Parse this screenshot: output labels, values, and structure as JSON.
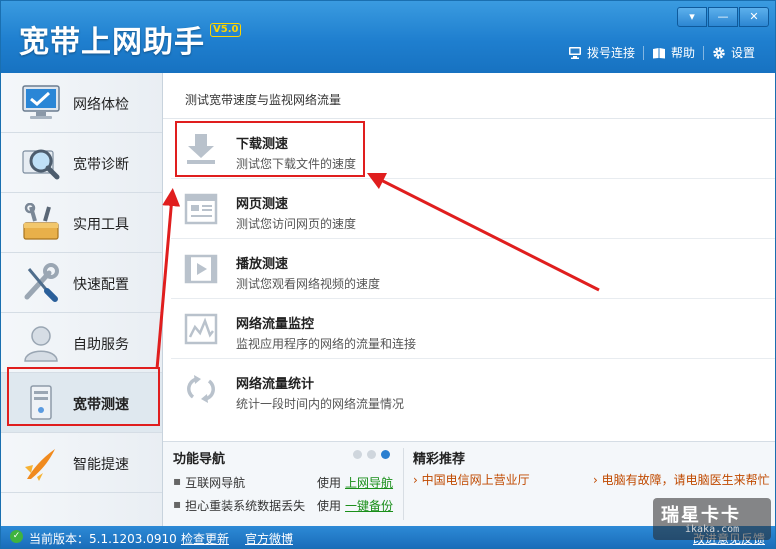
{
  "window": {
    "title": "宽带上网助手",
    "version_tag": "V5.0",
    "controls": [
      "▾",
      "—",
      "✕"
    ]
  },
  "top_menu": [
    {
      "label": "拨号连接",
      "icon": "dial-computer-icon"
    },
    {
      "label": "帮助",
      "icon": "book-icon"
    },
    {
      "label": "设置",
      "icon": "gear-icon"
    }
  ],
  "sidebar": {
    "items": [
      {
        "label": "网络体检",
        "icon": "monitor-icon"
      },
      {
        "label": "宽带诊断",
        "icon": "magnifier-icon"
      },
      {
        "label": "实用工具",
        "icon": "toolbox-icon"
      },
      {
        "label": "快速配置",
        "icon": "wrench-screwdriver-icon"
      },
      {
        "label": "自助服务",
        "icon": "person-icon"
      },
      {
        "label": "宽带测速",
        "icon": "server-icon",
        "active": true
      },
      {
        "label": "智能提速",
        "icon": "rocket-icon"
      }
    ]
  },
  "main": {
    "heading": "测试宽带速度与监视网络流量",
    "tools": [
      {
        "title": "下载测速",
        "desc": "测试您下载文件的速度",
        "icon": "download-icon"
      },
      {
        "title": "网页测速",
        "desc": "测试您访问网页的速度",
        "icon": "webpage-icon"
      },
      {
        "title": "播放测速",
        "desc": "测试您观看网络视频的速度",
        "icon": "film-icon"
      },
      {
        "title": "网络流量监控",
        "desc": "监视应用程序的网络的流量和连接",
        "icon": "traffic-chart-icon"
      },
      {
        "title": "网络流量统计",
        "desc": "统计一段时间内的网络流量情况",
        "icon": "sync-arrows-icon"
      }
    ]
  },
  "function_nav": {
    "title": "功能导航",
    "rows": [
      {
        "text": "互联网导航",
        "use": "使用",
        "link": "上网导航"
      },
      {
        "text": "担心重装系统数据丢失",
        "use": "使用",
        "link": "一键备份"
      }
    ]
  },
  "recommend": {
    "title": "精彩推荐",
    "links": [
      "› 中国电信网上营业厅",
      "› 电脑有故障，请电脑医生来帮忙"
    ]
  },
  "status_bar": {
    "version": "当前版本：5.1.1203.0910",
    "check_update": "检查更新",
    "weibo": "官方微博",
    "feedback": "改进意见反馈"
  },
  "watermark": {
    "text": "瑞星卡卡",
    "sub": "ikaka.com"
  }
}
